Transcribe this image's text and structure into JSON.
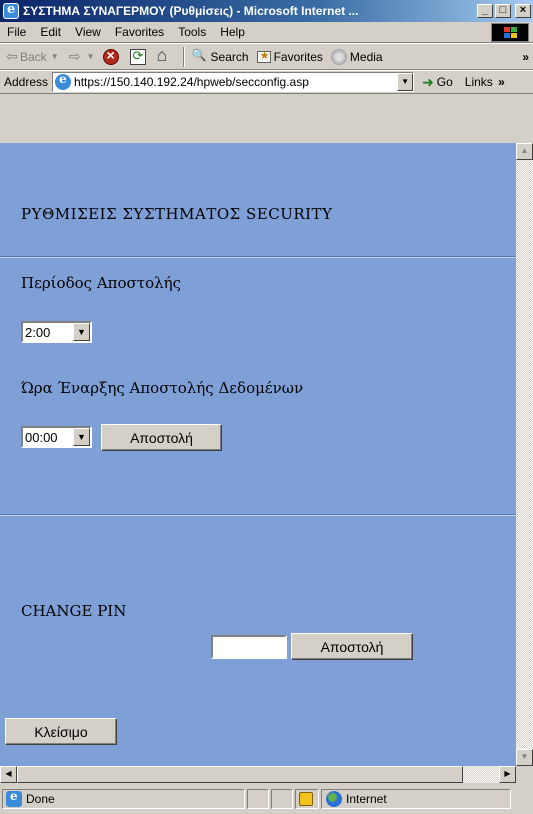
{
  "window": {
    "title": "ΣΥΣΤΗΜΑ ΣΥΝΑΓΕΡΜΟΥ (Ρυθμίσεις) - Microsoft Internet ...",
    "minimize": "_",
    "maximize": "□",
    "close": "×"
  },
  "menu": [
    "File",
    "Edit",
    "View",
    "Favorites",
    "Tools",
    "Help"
  ],
  "toolbar": {
    "back": "Back",
    "search": "Search",
    "favorites": "Favorites",
    "media": "Media",
    "more": "»"
  },
  "address": {
    "label": "Address",
    "url": "https://150.140.192.24/hpweb/secconfig.asp",
    "go": "Go",
    "links": "Links",
    "more": "»"
  },
  "page": {
    "heading": "ΡΥΘΜΙΣΕΙΣ ΣΥΣΤΗΜΑΤΟΣ SECURITY",
    "period_label": "Περίοδος Αποστολής",
    "period_value": "2:00",
    "start_label": "Ώρα Έναρξης Αποστολής Δεδομένων",
    "start_value": "00:00",
    "send_button": "Αποστολή",
    "pin_label": "CHANGE PIN",
    "pin_value": "",
    "pin_send_button": "Αποστολή",
    "close_button": "Κλείσιμο"
  },
  "status": {
    "text": "Done",
    "zone": "Internet"
  }
}
